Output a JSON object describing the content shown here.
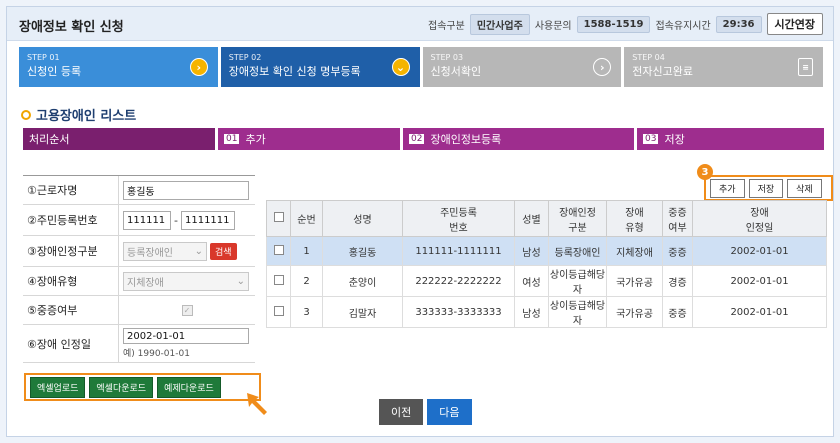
{
  "header": {
    "title": "장애정보 확인 신청",
    "conn_label": "접속구분",
    "conn_value": "민간사업주",
    "support_label": "사용문의",
    "support_phone": "1588-1519",
    "session_label": "접속유지시간",
    "session_time": "29:36",
    "extend_label": "시간연장"
  },
  "steps": [
    {
      "no": "STEP 01",
      "title": "신청인 등록",
      "icon": "chevron-right-icon"
    },
    {
      "no": "STEP 02",
      "title": "장애정보 확인 신청 명부등록",
      "icon": "chevron-down-icon"
    },
    {
      "no": "STEP 03",
      "title": "신청서확인",
      "icon": "chevron-right-icon"
    },
    {
      "no": "STEP 04",
      "title": "전자신고완료",
      "icon": "document-icon"
    }
  ],
  "section": {
    "title": "고용장애인 리스트"
  },
  "process": [
    {
      "no": "",
      "label": "처리순서"
    },
    {
      "no": "01",
      "label": "추가"
    },
    {
      "no": "02",
      "label": "장애인정보등록"
    },
    {
      "no": "03",
      "label": "저장"
    }
  ],
  "form": {
    "name_label": "①근로자명",
    "name_value": "홍길동",
    "rrn_label": "②주민등록번호",
    "rrn_front": "111111",
    "rrn_sep": "-",
    "rrn_back": "1111111",
    "type_label": "③장애인정구분",
    "type_value": "등록장애인",
    "search_label": "검색",
    "kind_label": "④장애유형",
    "kind_value": "지체장애",
    "severe_label": "⑤중증여부",
    "date_label": "⑥장애 인정일",
    "date_value": "2002-01-01",
    "date_hint": "예) 1990-01-01"
  },
  "download_buttons": [
    "엑셀업로드",
    "엑셀다운로드",
    "예제다운로드"
  ],
  "table_buttons": {
    "badge": "3",
    "add": "추가",
    "save": "저장",
    "delete": "삭제"
  },
  "table": {
    "headers": [
      "순번",
      "성명",
      "주민등록\n번호",
      "성별",
      "장애인정\n구분",
      "장애\n유형",
      "중증\n여부",
      "장애\n인정일"
    ],
    "rows": [
      {
        "no": "1",
        "name": "홍길동",
        "rrn": "111111-1111111",
        "sex": "남성",
        "type": "등록장애인",
        "kind": "지체장애",
        "severe": "중증",
        "date": "2002-01-01"
      },
      {
        "no": "2",
        "name": "춘양이",
        "rrn": "222222-2222222",
        "sex": "여성",
        "type": "상이등급해당자",
        "kind": "국가유공",
        "severe": "경증",
        "date": "2002-01-01"
      },
      {
        "no": "3",
        "name": "김말자",
        "rrn": "333333-3333333",
        "sex": "남성",
        "type": "상이등급해당자",
        "kind": "국가유공",
        "severe": "중증",
        "date": "2002-01-01"
      }
    ]
  },
  "nav": {
    "prev": "이전",
    "next": "다음"
  }
}
